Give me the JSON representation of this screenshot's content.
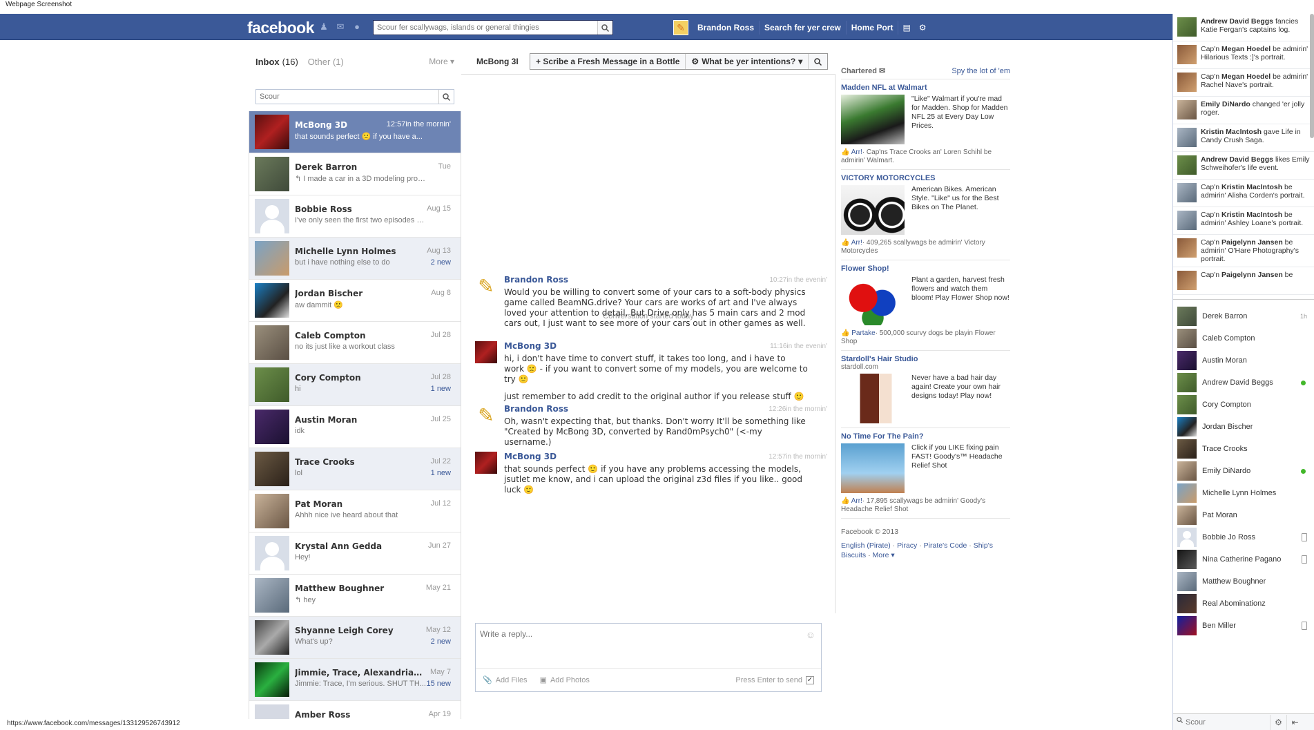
{
  "window": {
    "title": "Webpage Screenshot"
  },
  "topbar": {
    "logo": "facebook",
    "search_placeholder": "Scour fer scallywags, islands or general thingies",
    "user_name": "Brandon Ross",
    "find_friends": "Search fer yer crew",
    "home": "Home Port"
  },
  "inbox": {
    "label": "Inbox",
    "count": "(16)",
    "other": "Other",
    "other_count": "(1)",
    "more": "More ▾",
    "search_placeholder": "Scour"
  },
  "threads": [
    {
      "name": "McBong 3D",
      "snippet": "that sounds perfect 🙂 if you have a...",
      "time": "12:57in the mornin'",
      "new": "",
      "avatar": "c1",
      "state": "selected"
    },
    {
      "name": "Derek Barron",
      "snippet": "↰ I made a car in a 3D modeling prog...",
      "time": "Tue",
      "new": "",
      "avatar": "c2",
      "state": ""
    },
    {
      "name": "Bobbie Ross",
      "snippet": "I've only seen the first two episodes s...",
      "time": "Aug 15",
      "new": "",
      "avatar": "silhouette",
      "state": ""
    },
    {
      "name": "Michelle Lynn Holmes",
      "snippet": "but i have nothing else to do",
      "time": "Aug 13",
      "new": "2 new",
      "avatar": "c4",
      "state": "unread"
    },
    {
      "name": "Jordan Bischer",
      "snippet": "aw dammit 🙁",
      "time": "Aug 8",
      "new": "",
      "avatar": "c5",
      "state": ""
    },
    {
      "name": "Caleb Compton",
      "snippet": "no its just like a workout class",
      "time": "Jul 28",
      "new": "",
      "avatar": "c6",
      "state": ""
    },
    {
      "name": "Cory Compton",
      "snippet": "hi",
      "time": "Jul 28",
      "new": "1 new",
      "avatar": "c7",
      "state": "unread"
    },
    {
      "name": "Austin Moran",
      "snippet": "idk",
      "time": "Jul 25",
      "new": "",
      "avatar": "c8",
      "state": ""
    },
    {
      "name": "Trace Crooks",
      "snippet": "lol",
      "time": "Jul 22",
      "new": "1 new",
      "avatar": "c9",
      "state": "unread"
    },
    {
      "name": "Pat Moran",
      "snippet": "Ahhh nice ive heard about that",
      "time": "Jul 12",
      "new": "",
      "avatar": "c10",
      "state": ""
    },
    {
      "name": "Krystal Ann Gedda",
      "snippet": "Hey!",
      "time": "Jun 27",
      "new": "",
      "avatar": "silhouette",
      "state": ""
    },
    {
      "name": "Matthew Boughner",
      "snippet": "↰ hey",
      "time": "May 21",
      "new": "",
      "avatar": "c11",
      "state": ""
    },
    {
      "name": "Shyanne Leigh Corey",
      "snippet": "What's up?",
      "time": "May 12",
      "new": "2 new",
      "avatar": "c12",
      "state": "unread"
    },
    {
      "name": "Jimmie, Trace, Alexandria, 3",
      "snippet": "Jimmie: Trace, I'm serious. SHUT TH...",
      "time": "May 7",
      "new": "15 new",
      "avatar": "c13",
      "state": "unread"
    },
    {
      "name": "Amber Ross",
      "snippet": "",
      "time": "Apr 19",
      "new": "",
      "avatar": "c3",
      "state": ""
    }
  ],
  "conversation": {
    "name": "McBong 3I",
    "new_message": "+ Scribe a Fresh Message in a Bottle",
    "actions": "What be yer intentions?",
    "started": "Conversation started today",
    "messages": [
      {
        "name": "Brandon Ross",
        "time": "10:27in the evenin'",
        "paragraphs": [
          "Would you be willing to convert some of your cars to a soft-body physics game called BeamNG.drive? Your cars are works of art and I've always loved your attention to detail, But Drive only has 5 main cars and 2 mod cars out, I just want to see more of your cars out in other games as well."
        ]
      },
      {
        "name": "McBong 3D",
        "time": "11:16in the evenin'",
        "paragraphs": [
          "hi, i don't have time to convert stuff, it takes too long, and i have to work 🙁 - if you want to convert some of my models, you are welcome to try 🙂",
          "just remember to add credit to the original author if you release stuff 🙂"
        ]
      },
      {
        "name": "Brandon Ross",
        "time": "12:26in the mornin'",
        "paragraphs": [
          "Oh, wasn't expecting that, but thanks. Don't worry It'll be something like \"Created by McBong 3D, converted by Rand0mPsych0\" (<-my username.)"
        ]
      },
      {
        "name": "McBong 3D",
        "time": "12:57in the mornin'",
        "paragraphs": [
          "that sounds perfect 🙂 if you have any problems accessing the models, jsutlet me know, and i can upload the original z3d files if you like.. good luck 🙂"
        ]
      }
    ],
    "reply_placeholder": "Write a reply...",
    "add_files": "Add Files",
    "add_photos": "Add Photos",
    "press_enter": "Press Enter to send"
  },
  "sponsored": {
    "title": "Chartered",
    "see_all": "Spy the lot of 'em",
    "ads": [
      {
        "title": "Madden NFL at Walmart",
        "sub": "",
        "desc": "\"Like\" Walmart if you're mad for Madden. Shop for Madden NFL 25 at Every Day Low Prices.",
        "action": "Arr!",
        "social": "· Cap'ns Trace Crooks an' Loren Schihl be admirin' Walmart.",
        "img": "ad-img-1"
      },
      {
        "title": "VICTORY MOTORCYCLES",
        "sub": "",
        "desc": "American Bikes. American Style. \"Like\" us for the Best Bikes on The Planet.",
        "action": "Arr!",
        "social": "· 409,265 scallywags be admirin' Victory Motorcycles",
        "img": "ad-img-2"
      },
      {
        "title": "Flower Shop!",
        "sub": "",
        "desc": "Plant a garden, harvest fresh flowers and watch them bloom! Play Flower Shop now!",
        "action": "Partake",
        "social": "· 500,000 scurvy dogs be playin Flower Shop",
        "img": "ad-img-3"
      },
      {
        "title": "Stardoll's Hair Studio",
        "sub": "stardoll.com",
        "desc": "Never have a bad hair day again! Create your own hair designs today! Play now!",
        "action": "",
        "social": "",
        "img": "ad-img-4"
      },
      {
        "title": "No Time For The Pain?",
        "sub": "",
        "desc": "Click if you LIKE fixing pain FAST! Goody's™ Headache Relief Shot",
        "action": "Arr!",
        "social": "· 17,895 scallywags be admirin' Goody's Headache Relief Shot",
        "img": "ad-img-5"
      }
    ],
    "footer": {
      "copyright": "Facebook © 2013",
      "links": [
        "English (Pirate)",
        "Piracy",
        "Pirate's Code",
        "Ship's Biscuits",
        "More ▾"
      ]
    }
  },
  "ticker": [
    {
      "actor": "Andrew David Beggs",
      "text": " fancies Katie Fergan's captains log.",
      "pre": "",
      "avatar": "c7"
    },
    {
      "actor": "Megan Hoedel",
      "text": " be admirin' Hilarious Texts :]'s portrait.",
      "pre": "Cap'n ",
      "avatar": "c15"
    },
    {
      "actor": "Megan Hoedel",
      "text": " be admirin' Rachel Nave's portrait.",
      "pre": "Cap'n ",
      "avatar": "c15"
    },
    {
      "actor": "Emily DiNardo",
      "text": " changed 'er jolly roger.",
      "pre": "",
      "avatar": "c10"
    },
    {
      "actor": "Kristin MacIntosh",
      "text": " gave Life in Candy Crush Saga.",
      "pre": "",
      "avatar": "c11"
    },
    {
      "actor": "Andrew David Beggs",
      "text": " likes Emily Schweihofer's life event.",
      "pre": "",
      "avatar": "c7"
    },
    {
      "actor": "Kristin MacIntosh",
      "text": " be admirin' Alisha Corden's portrait.",
      "pre": "Cap'n ",
      "avatar": "c11"
    },
    {
      "actor": "Kristin MacIntosh",
      "text": " be admirin' Ashley Loane's portrait.",
      "pre": "Cap'n ",
      "avatar": "c11"
    },
    {
      "actor": "Paigelynn Jansen",
      "text": " be admirin' O'Hare Photography's portrait.",
      "pre": "Cap'n ",
      "avatar": "c15"
    },
    {
      "actor": "Paigelynn Jansen",
      "text": " be",
      "pre": "Cap'n ",
      "avatar": "c15"
    }
  ],
  "buddies": [
    {
      "name": "Derek Barron",
      "status": "1h",
      "kind": "time",
      "avatar": "c2"
    },
    {
      "name": "Caleb Compton",
      "status": "",
      "kind": "",
      "avatar": "c6"
    },
    {
      "name": "Austin Moran",
      "status": "",
      "kind": "",
      "avatar": "c8"
    },
    {
      "name": "Andrew David Beggs",
      "status": "",
      "kind": "online",
      "avatar": "c7"
    },
    {
      "name": "Cory Compton",
      "status": "",
      "kind": "",
      "avatar": "c7"
    },
    {
      "name": "Jordan Bischer",
      "status": "",
      "kind": "",
      "avatar": "c5"
    },
    {
      "name": "Trace Crooks",
      "status": "",
      "kind": "",
      "avatar": "c9"
    },
    {
      "name": "Emily DiNardo",
      "status": "",
      "kind": "online",
      "avatar": "c10"
    },
    {
      "name": "Michelle Lynn Holmes",
      "status": "",
      "kind": "",
      "avatar": "c4"
    },
    {
      "name": "Pat Moran",
      "status": "",
      "kind": "",
      "avatar": "c10"
    },
    {
      "name": "Bobbie Jo Ross",
      "status": "",
      "kind": "mobile",
      "avatar": "silhouette"
    },
    {
      "name": "Nina Catherine Pagano",
      "status": "",
      "kind": "mobile",
      "avatar": "c16"
    },
    {
      "name": "Matthew Boughner",
      "status": "",
      "kind": "",
      "avatar": "c11"
    },
    {
      "name": "Real Abominationz",
      "status": "",
      "kind": "",
      "avatar": "c14"
    },
    {
      "name": "Ben Miller",
      "status": "",
      "kind": "mobile",
      "avatar": "c17"
    }
  ],
  "chat_search_placeholder": "Scour",
  "status_url": "https://www.facebook.com/messages/133129526743912"
}
